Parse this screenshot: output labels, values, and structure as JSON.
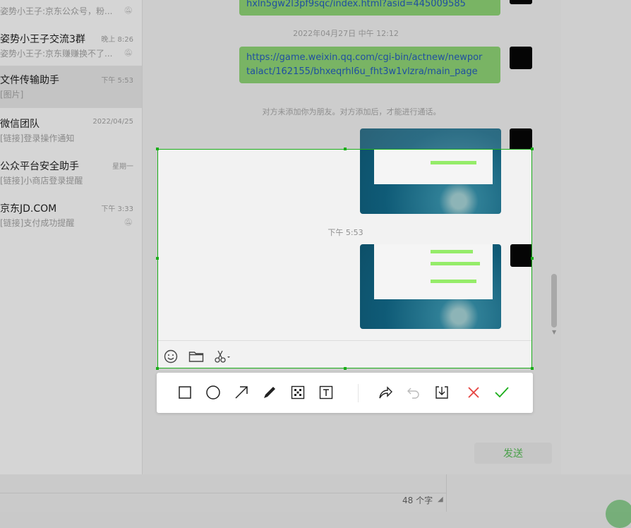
{
  "chat_list": [
    {
      "name": "",
      "preview": "姿势小王子:京东公众号，粉...",
      "time": "",
      "muted": true
    },
    {
      "name": "姿势小王子交流3群",
      "preview": "姿势小王子:京东赚赚换不了...",
      "time": "晚上 8:26",
      "muted": true
    },
    {
      "name": "文件传输助手",
      "preview": "[图片]",
      "time": "下午 5:53",
      "muted": false,
      "active": true
    },
    {
      "name": "微信团队",
      "preview": "[链接]登录操作通知",
      "time": "2022/04/25",
      "muted": false
    },
    {
      "name": "公众平台安全助手",
      "preview": "[链接]小商店登录提醒",
      "time": "星期一",
      "muted": false
    },
    {
      "name": "京东JD.COM",
      "preview": "[链接]支付成功提醒",
      "time": "下午 3:33",
      "muted": true
    }
  ],
  "messages": {
    "link1_tail": "hxln5gw2l3pf9sqc/index.html?asid=445009585",
    "timestamp1": "2022年04月27日 中午 12:12",
    "link2_line1": "https://game.weixin.qq.com/cgi-bin/actnew/newpor",
    "link2_line2": "talact/162155/bhxeqrhl6u_fht3w1vlzra/main_page",
    "system_notice": "对方未添加你为朋友。对方添加后，才能进行通话。",
    "timestamp2": "下午 5:53"
  },
  "input": {
    "char_count": "48 个字",
    "send_label": "发送"
  },
  "screenshot_toolbar": {
    "tools": [
      "rectangle-icon",
      "ellipse-icon",
      "arrow-icon",
      "pen-icon",
      "mosaic-icon",
      "text-icon"
    ],
    "actions": [
      "share-icon",
      "undo-icon",
      "save-icon",
      "cancel-icon",
      "confirm-icon"
    ],
    "accent": "#1aad19",
    "cancel_color": "#e64340",
    "confirm_color": "#1aad19"
  },
  "input_toolbar_icons": [
    "emoji-icon",
    "folder-icon",
    "scissors-icon"
  ]
}
